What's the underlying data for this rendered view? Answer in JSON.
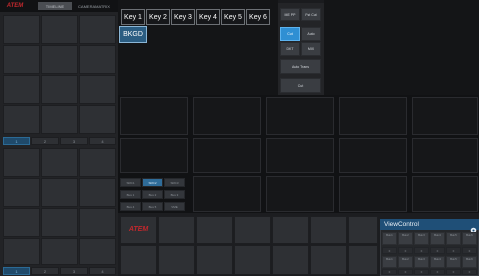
{
  "left_panel": {
    "logo_text": "ATEM",
    "tab_active": "TIMELINE",
    "tab_other": "CAMERAMATRIX",
    "page_tabs_top": [
      "1",
      "2",
      "3",
      "4"
    ],
    "page_tabs_bottom": [
      "1",
      "2",
      "3",
      "4"
    ]
  },
  "keys": {
    "key_labels": [
      "Key 1",
      "Key 2",
      "Key 3",
      "Key 4",
      "Key 5",
      "Key 6"
    ],
    "bkgd_label": "BKGD"
  },
  "transition": {
    "me_pp_label": "ME PP",
    "ftb_cut_label": "Fst Cut",
    "cut_label": "Cut",
    "auto_label": "Auto",
    "dsk_label": "DKT",
    "mix_label": "MIX",
    "auto_trans_label": "Auto Trans",
    "cut2_label": "Cut"
  },
  "small_buttons": {
    "row1": [
      "SRC1",
      "SRC2",
      "SRC3"
    ],
    "row2": [
      "Bus 1",
      "Bus 2",
      "Bus 3"
    ],
    "row3": [
      "Bus 4",
      "Bus 5",
      "VME"
    ]
  },
  "bottom_bar": {
    "logo_text": "ATEM"
  },
  "view_control": {
    "title": "ViewControl",
    "row_labels": [
      "Bus 1",
      "Bus 2",
      "Bus 3",
      "Bus 4",
      "Bus 5",
      "Bus 6"
    ],
    "dot_rows": [
      "≡",
      "≡",
      "≡",
      "≡",
      "≡",
      "≡"
    ]
  },
  "colors": {
    "accent": "#2f8fd3",
    "logo_red": "#c0282d",
    "background": "#1a1b1e"
  }
}
